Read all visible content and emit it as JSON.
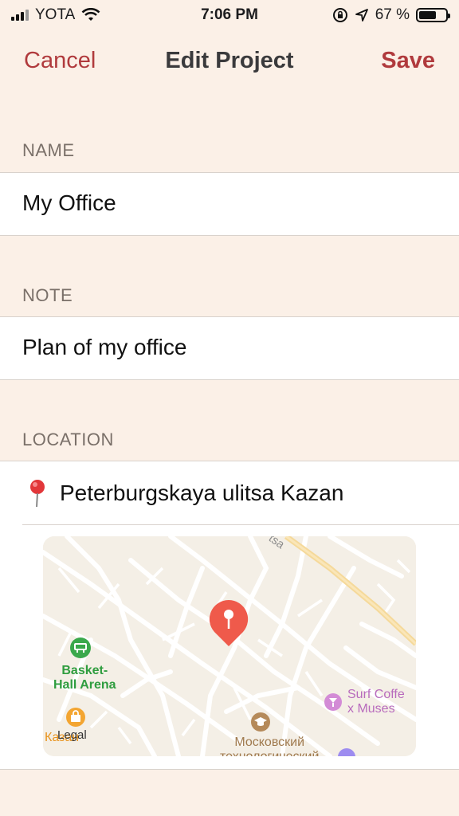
{
  "status_bar": {
    "carrier": "YOTA",
    "time": "7:06 PM",
    "battery_percent": "67 %",
    "battery_level": 0.67
  },
  "nav": {
    "cancel": "Cancel",
    "title": "Edit Project",
    "save": "Save"
  },
  "sections": {
    "name_header": "NAME",
    "name_value": "My Office",
    "note_header": "NOTE",
    "note_value": "Plan of my office",
    "location_header": "LOCATION",
    "location_value": "Peterburgskaya ulitsa Kazan"
  },
  "map": {
    "street_fragment": "tsa",
    "poi_basket_line1": "Basket-",
    "poi_basket_line2": "Hall Arena",
    "poi_surf_line1": "Surf Coffe",
    "poi_surf_line2": "x Muses",
    "poi_kazan": "Казан",
    "poi_moscow_line1": "Московский",
    "poi_moscow_line2": "технологический",
    "legal": "Legal"
  },
  "colors": {
    "accent": "#b03a3d",
    "background": "#fbf0e7",
    "pin": "#ef5a4b"
  },
  "icons": {
    "location_pin": "red-pushpin",
    "map_marker": "map-pin",
    "basketball": "basketball-poi",
    "cafe": "cocktail-poi",
    "education": "graduation-cap-poi",
    "shopping": "shopping-bag-poi"
  }
}
